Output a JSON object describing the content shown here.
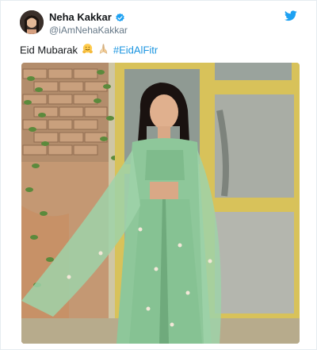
{
  "tweet": {
    "author": {
      "display_name": "Neha Kakkar",
      "handle": "@iAmNehaKakkar",
      "verified": true
    },
    "text_prefix": "Eid Mubarak",
    "emojis": [
      "hugging-face-emoji",
      "folded-hands-emoji"
    ],
    "hashtag": "#EidAlFitr",
    "media": {
      "type": "photo",
      "icon": "photo"
    }
  },
  "colors": {
    "twitter_blue": "#1da1f2",
    "hashtag_blue": "#1b95e0",
    "text_primary": "#14171a",
    "text_secondary": "#657786",
    "outfit_green": "#8ec79a"
  },
  "icons": {
    "brand": "twitter-bird-icon",
    "verified": "verified-badge-icon"
  }
}
